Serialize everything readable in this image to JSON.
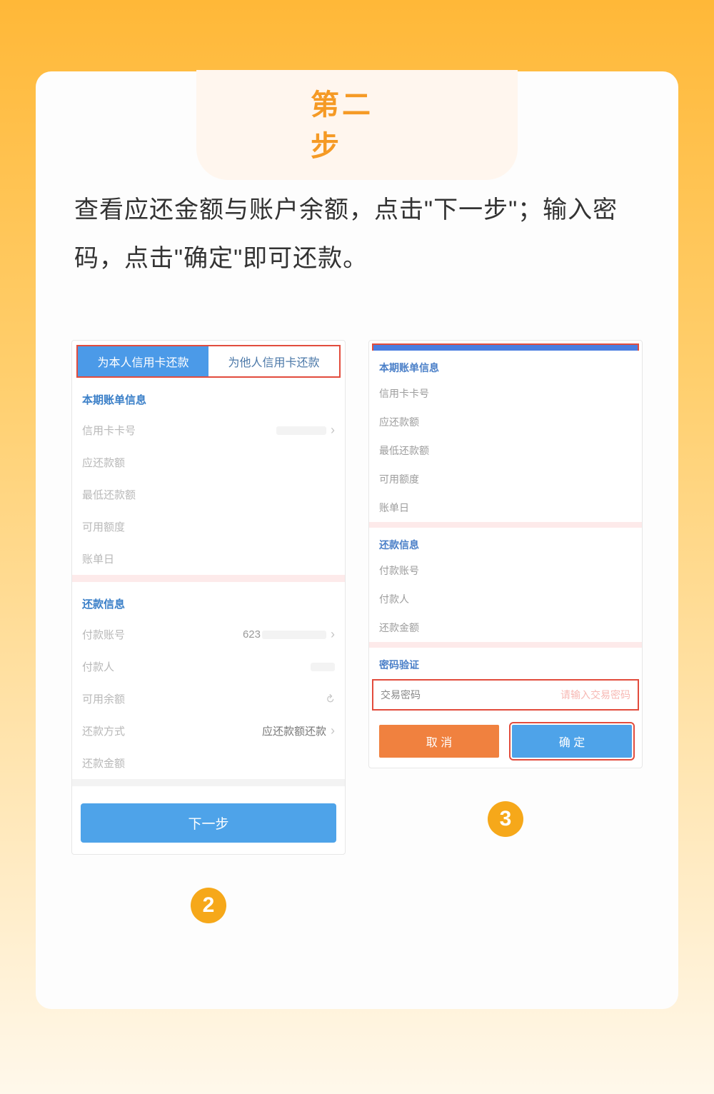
{
  "step_title": "第二步",
  "instruction": "查看应还金额与账户余额，点击\"下一步\"；输入密码，点击\"确定\"即可还款。",
  "left": {
    "tab_self": "为本人信用卡还款",
    "tab_other": "为他人信用卡还款",
    "section_bill": "本期账单信息",
    "card_no_label": "信用卡卡号",
    "due_amount_label": "应还款额",
    "min_due_label": "最低还款额",
    "avail_credit_label": "可用额度",
    "bill_day_label": "账单日",
    "section_repay": "还款信息",
    "pay_account_label": "付款账号",
    "pay_account_value": "623",
    "payer_label": "付款人",
    "avail_balance_label": "可用余额",
    "repay_method_label": "还款方式",
    "repay_method_value": "应还款额还款",
    "repay_amount_label": "还款金额",
    "next_btn": "下一步",
    "circle": "2"
  },
  "right": {
    "section_bill": "本期账单信息",
    "card_no_label": "信用卡卡号",
    "due_amount_label": "应还款额",
    "min_due_label": "最低还款额",
    "avail_credit_label": "可用额度",
    "bill_day_label": "账单日",
    "section_repay": "还款信息",
    "pay_account_label": "付款账号",
    "payer_label": "付款人",
    "repay_amount_label": "还款金额",
    "section_pw": "密码验证",
    "pw_label": "交易密码",
    "pw_placeholder": "请输入交易密码",
    "cancel_btn": "取 消",
    "ok_btn": "确 定",
    "circle": "3"
  }
}
